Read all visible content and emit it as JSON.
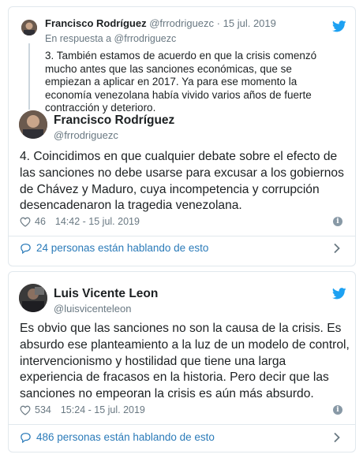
{
  "tweet1": {
    "quoted": {
      "name": "Francisco Rodríguez",
      "handle": "@frrodriguezc",
      "sep": "·",
      "date": "15 jul. 2019",
      "reply_to": "En respuesta a @frrodriguezc",
      "text": "3. También estamos de acuerdo en que la crisis comenzó mucho antes que las sanciones económicas, que se empiezan a aplicar en 2017.  Ya para ese momento la economía venezolana había vivido varios años de fuerte contracción y deterioro."
    },
    "name": "Francisco Rodríguez",
    "handle": "@frrodriguezc",
    "text": "4. Coincidimos en que cualquier debate sobre el efecto de las sanciones no debe usarse para excusar a los gobiernos de Chávez y Maduro, cuya incompetencia y corrupción desencadenaron la tragedia venezolana.",
    "likes": "46",
    "timestamp": "14:42 - 15 jul. 2019",
    "talking": "24 personas están hablando de esto"
  },
  "tweet2": {
    "name": "Luis Vicente Leon",
    "handle": "@luisvicenteleon",
    "text": "Es obvio que las sanciones no son la causa de la crisis. Es absurdo ese planteamiento a la luz de un modelo de control, intervencionismo y hostilidad que tiene una larga experiencia de fracasos en la historia. Pero decir que las sanciones no empeoran la crisis es aún más absurdo.",
    "likes": "534",
    "timestamp": "15:24 - 15 jul. 2019",
    "talking": "486 personas están hablando de esto"
  },
  "icons": {
    "brand": "twitter-bird-icon",
    "like": "heart-icon",
    "info": "info-icon",
    "talk": "speech-bubble-icon",
    "more": "chevron-right-icon"
  },
  "colors": {
    "brand_blue": "#1da1f2",
    "link_blue": "#2b7bb9",
    "muted": "#697882",
    "text": "#1c2022",
    "border": "#e1e8ed"
  }
}
